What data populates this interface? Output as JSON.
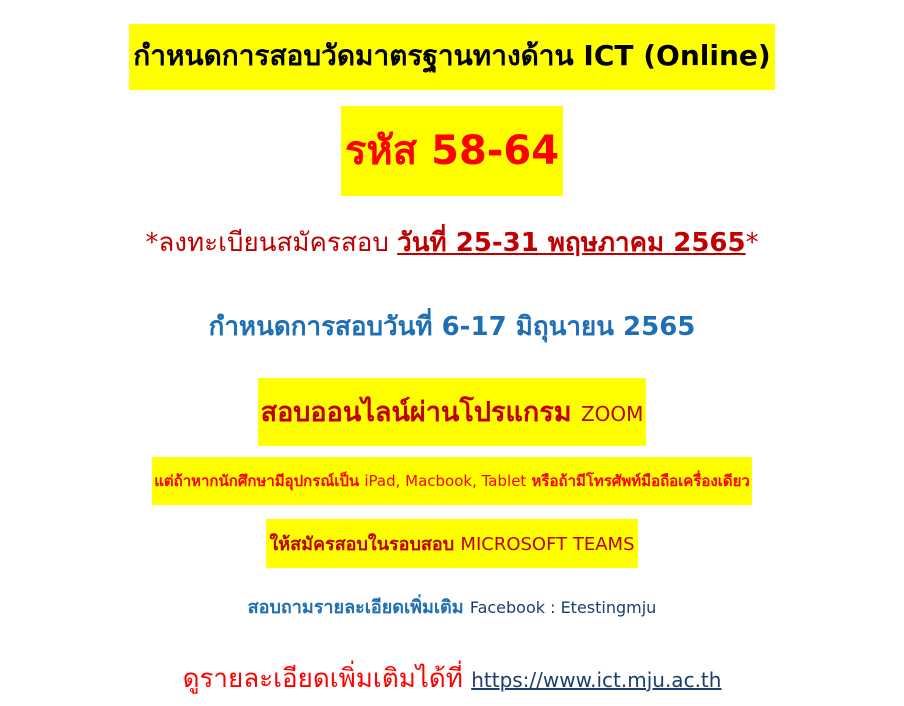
{
  "title": "กำหนดการสอบวัดมาตรฐานทางด้าน ICT (Online)",
  "code": "รหัส 58-64",
  "registration": {
    "prefix": "*ลงทะเบียนสมัครสอบ ",
    "dates": "วันที่ 25-31 พฤษภาคม 2565",
    "suffix": "*"
  },
  "exam_schedule": "กำหนดการสอบวันที่ 6-17 มิถุนายน 2565",
  "online_program": {
    "text": "สอบออนไลน์ผ่านโปรแกรม ",
    "program": "ZOOM"
  },
  "device_note": {
    "part1": "แต่ถ้าหากนักศึกษามีอุปกรณ์เป็น ",
    "devices": "iPad, Macbook, Tablet",
    "part2": " หรือถ้ามีโทรศัพท์มือถือเครื่องเดียว"
  },
  "teams_note": {
    "text": "ให้สมัครสอบในรอบสอบ ",
    "program": "MICROSOFT TEAMS"
  },
  "contact": {
    "text": "สอบถามรายละเอียดเพิ่มเติม ",
    "facebook": "Facebook : Etestingmju"
  },
  "more_info": {
    "text": "ดูรายละเอียดเพิ่มเติมได้ที่ ",
    "url": "https://www.ict.mju.ac.th"
  },
  "colors": {
    "highlight": "#ffff00",
    "red": "#ff0000",
    "dark_red": "#c00000",
    "blue": "#1f6fb6"
  }
}
